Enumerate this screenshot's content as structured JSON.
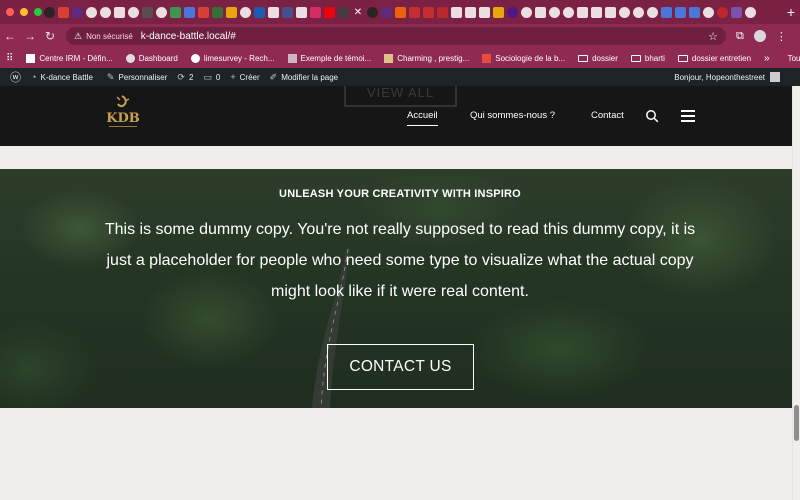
{
  "browser": {
    "url_warning": "Non sécurisé",
    "url": "k-dance-battle.local/#",
    "bookmarks": [
      {
        "label": "Centre IRM - Défin..."
      },
      {
        "label": "Dashboard"
      },
      {
        "label": "limesurvey - Rech..."
      },
      {
        "label": "Exemple de témoi..."
      },
      {
        "label": "Charming , prestig..."
      },
      {
        "label": "Sociologie de la b..."
      },
      {
        "label": "dossier"
      },
      {
        "label": "bharti"
      },
      {
        "label": "dossier entretien"
      }
    ],
    "bookmarks_overflow": "»",
    "all_bookmarks": "Tous les favoris"
  },
  "adminbar": {
    "site_name": "K-dance Battle",
    "customize": "Personnaliser",
    "updates_count": "2",
    "comments_count": "0",
    "new_label": "Créer",
    "edit_page": "Modifier la page",
    "greeting": "Bonjour, Hopeonthestreet"
  },
  "header": {
    "behind_button": "VIEW ALL",
    "logo_text": "KDB",
    "nav": [
      {
        "label": "Accueil",
        "active": true
      },
      {
        "label": "Qui sommes-nous ?"
      },
      {
        "label": "Contact"
      }
    ]
  },
  "hero": {
    "kicker": "UNLEASH YOUR CREATIVITY WITH INSPIRO",
    "copy": "This is some dummy copy. You're not really supposed to read this dummy copy, it is just a placeholder for people who need some type to visualize what the actual copy might look like if it were real content.",
    "cta_label": "CONTACT US"
  },
  "colors": {
    "tab_bar": "#7b2244",
    "toolbar": "#8f2a52",
    "admin_bar": "#1d2327",
    "site_header": "#161616",
    "page_bg": "#f0eeeb",
    "logo_gold": "#c9a24a"
  }
}
